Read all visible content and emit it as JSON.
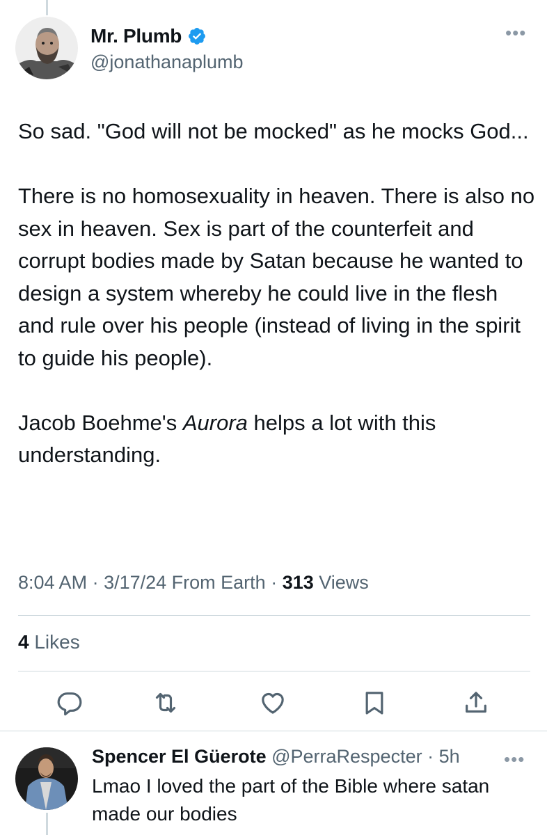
{
  "tweet": {
    "author": {
      "name": "Mr. Plumb",
      "handle": "@jonathanaplumb"
    },
    "paragraphs": {
      "p1": "So sad. \"God will not be mocked\" as he mocks God...",
      "p2": "There is no homosexuality in heaven. There is also no sex in heaven. Sex is part of the counterfeit and corrupt bodies made by Satan because he wanted to design a system whereby he could live in the flesh and rule over his people (instead of living in the spirit to guide his people).",
      "p3_before": "Jacob Boehme's ",
      "p3_italic": "Aurora",
      "p3_after": " helps a lot with this understanding."
    },
    "meta": {
      "time": "8:04 AM",
      "sep1": " · ",
      "date": "3/17/24",
      "source": " From Earth",
      "sep2": " · ",
      "views_count": "313",
      "views_label": " Views"
    },
    "likes": {
      "count": "4",
      "label": " Likes"
    }
  },
  "reply": {
    "name": "Spencer El Güerote",
    "handle": " @PerraRespecter",
    "sep": " · ",
    "time": "5h",
    "text": "Lmao I loved the part of the Bible where satan made our bodies"
  },
  "icons": {
    "more": "more-icon",
    "verified": "verified-badge-icon",
    "reply": "reply-icon",
    "retweet": "retweet-icon",
    "like": "heart-icon",
    "bookmark": "bookmark-icon",
    "share": "share-icon"
  },
  "colors": {
    "text": "#0f1419",
    "secondary": "#536471",
    "divider": "#cfd9de",
    "verified": "#1d9bf0"
  }
}
